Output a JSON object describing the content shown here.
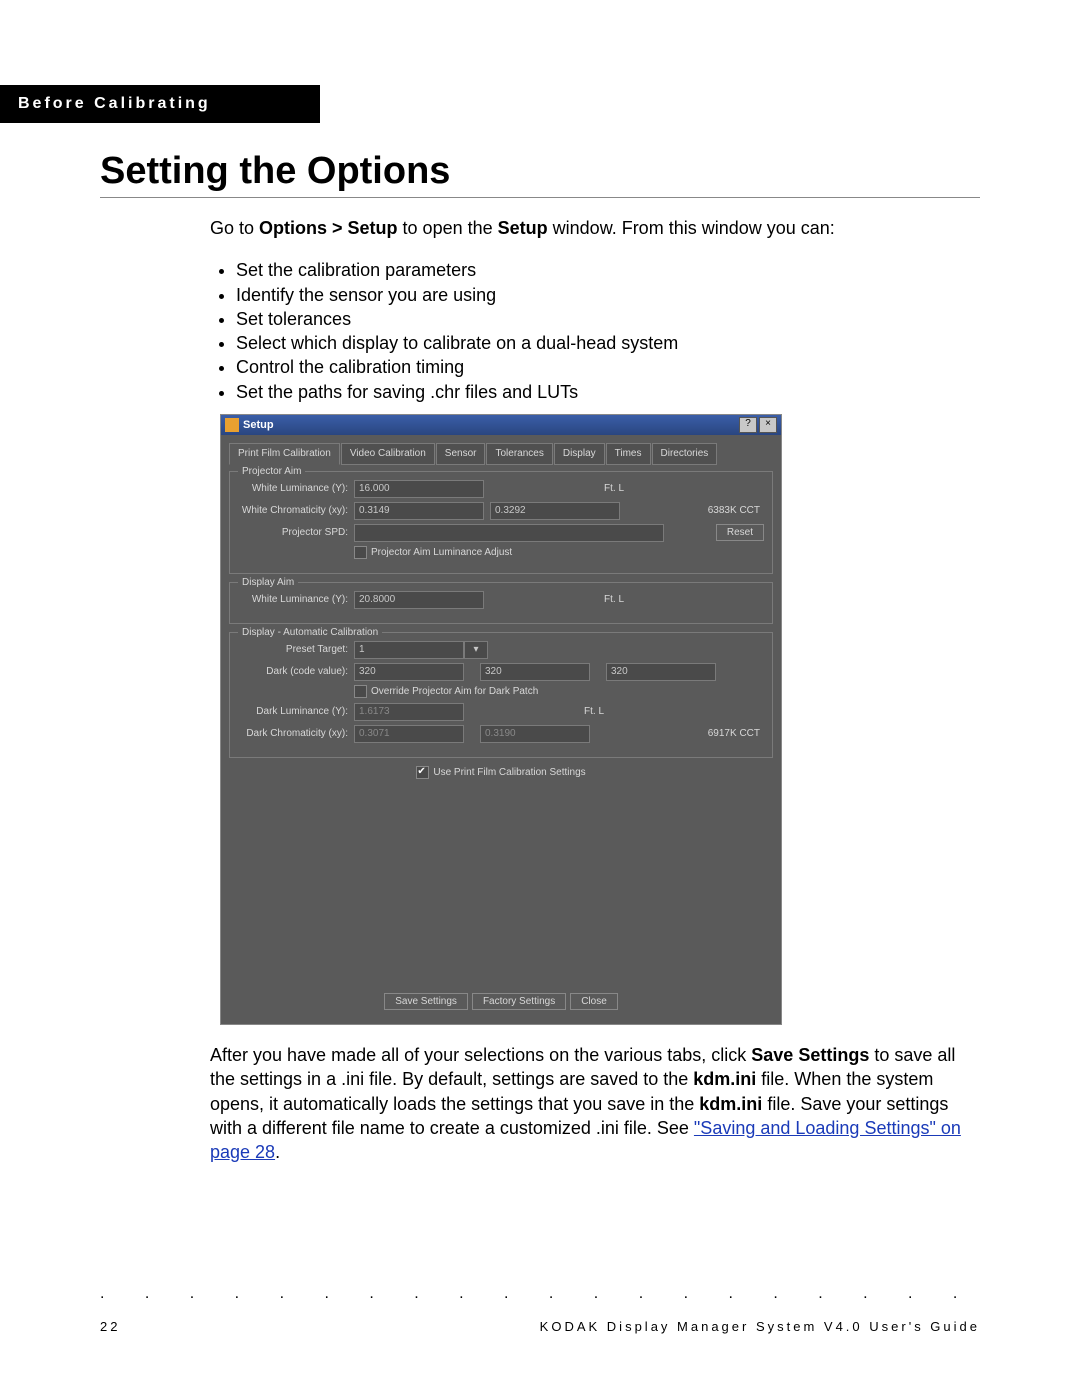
{
  "header": "Before Calibrating",
  "title": "Setting the Options",
  "intro_pre": "Go to ",
  "intro_b1": "Options > Setup",
  "intro_mid": " to open the ",
  "intro_b2": "Setup",
  "intro_post": " window. From this window you can:",
  "bullets": [
    "Set the calibration parameters",
    "Identify the sensor you are using",
    "Set tolerances",
    "Select which display to calibrate on a dual-head system",
    "Control the calibration timing",
    "Set the paths for saving .chr files and LUTs"
  ],
  "win": {
    "title": "Setup",
    "tabs": [
      "Print Film Calibration",
      "Video Calibration",
      "Sensor",
      "Tolerances",
      "Display",
      "Times",
      "Directories"
    ],
    "proj_group": "Projector Aim",
    "labels": {
      "wlum": "White Luminance (Y):",
      "wchrom": "White Chromaticity (xy):",
      "spd": "Projector SPD:",
      "adjcheck": "Projector Aim Luminance Adjust",
      "disp_group": "Display Aim",
      "auto_group": "Display - Automatic Calibration",
      "preset": "Preset Target:",
      "dark": "Dark (code value):",
      "override": "Override Projector Aim for Dark Patch",
      "dlum": "Dark Luminance (Y):",
      "dchrom": "Dark Chromaticity (xy):",
      "usepf": "Use Print Film Calibration Settings"
    },
    "vals": {
      "wlum": "16.000",
      "ftl": "Ft. L",
      "wx": "0.3149",
      "wy": "0.3292",
      "wcct": "6383K CCT",
      "reset": "Reset",
      "dwlum": "20.8000",
      "preset": "1",
      "dark1": "320",
      "dark2": "320",
      "dark3": "320",
      "dlum": "1.6173",
      "dx": "0.3071",
      "dy": "0.3190",
      "dcct": "6917K CCT"
    },
    "btns": {
      "save": "Save Settings",
      "factory": "Factory Settings",
      "close": "Close"
    }
  },
  "para2_1": "After you have made all of your selections on the various tabs, click ",
  "para2_b1": "Save Settings",
  "para2_2": " to save all the settings in a .ini file. By default, settings are saved to the ",
  "para2_b2": "kdm.ini",
  "para2_3": " file. When the system opens, it automatically loads the settings that you save in the ",
  "para2_b3": "kdm.ini",
  "para2_4": " file. Save your settings with a different file name to create a customized .ini file. See ",
  "link": "\"Saving and Loading Settings\" on page 28",
  "para2_5": ".",
  "page_num": "22",
  "footer_right": "KODAK Display Manager System V4.0 User's Guide"
}
